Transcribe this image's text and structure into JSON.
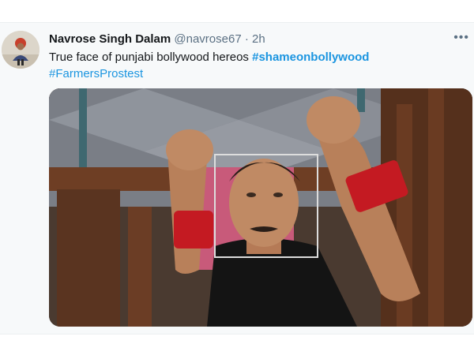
{
  "tweet": {
    "author_name": "Navrose Singh Dalam",
    "handle": "@navrose67",
    "separator": "·",
    "time": "2h",
    "more_icon": "more-icon",
    "text_plain": "True face of punjabi bollywood hereos",
    "hashtag_1": "#shameonbollywood",
    "hashtag_2": "#FarmersProstest",
    "hashtag_color": "#1b95e0",
    "avatar_icon": "user-avatar"
  }
}
